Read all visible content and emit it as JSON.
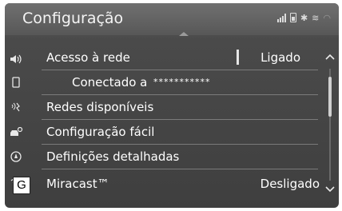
{
  "header": {
    "title": "Configuração"
  },
  "menu": {
    "network_access": {
      "label": "Acesso à rede",
      "value": "Ligado"
    },
    "connected": {
      "label": "Conectado a",
      "value": "***********"
    },
    "available_networks": {
      "label": "Redes disponíveis"
    },
    "easy_setup": {
      "label": "Configuração fácil"
    },
    "detailed_settings": {
      "label": "Definições detalhadas"
    },
    "miracast": {
      "label": "Miracast™",
      "value": "Desligado"
    }
  },
  "badge": {
    "letter": "G"
  },
  "icons": {
    "sidebar": [
      "volume-icon",
      "phone-icon",
      "wireless-icon",
      "car-settings-icon",
      "navigation-icon",
      "wifi-icon"
    ],
    "status": [
      "signal-icon",
      "battery-icon",
      "bluetooth-icon",
      "wifi-icon"
    ]
  }
}
